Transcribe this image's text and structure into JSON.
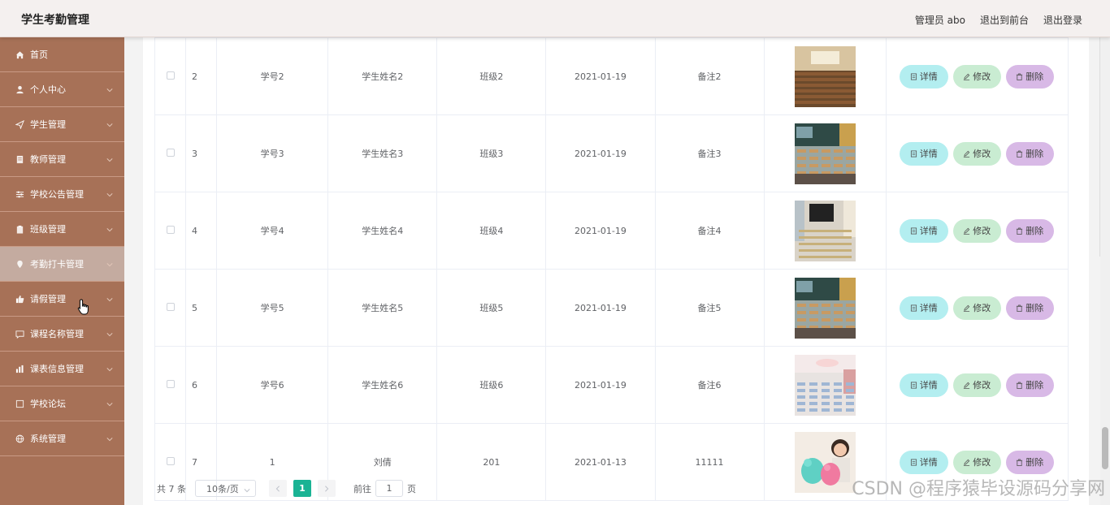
{
  "app": {
    "title": "学生考勤管理"
  },
  "header": {
    "user_label": "管理员 abo",
    "to_front": "退出到前台",
    "logout": "退出登录"
  },
  "sidebar": {
    "items": [
      {
        "label": "首页",
        "icon": "home-icon",
        "has_children": false
      },
      {
        "label": "个人中心",
        "icon": "user-icon",
        "has_children": true
      },
      {
        "label": "学生管理",
        "icon": "send-icon",
        "has_children": true
      },
      {
        "label": "教师管理",
        "icon": "document-icon",
        "has_children": true
      },
      {
        "label": "学校公告管理",
        "icon": "sliders-icon",
        "has_children": true
      },
      {
        "label": "班级管理",
        "icon": "clipboard-icon",
        "has_children": true
      },
      {
        "label": "考勤打卡管理",
        "icon": "location-icon",
        "has_children": true,
        "active": true
      },
      {
        "label": "请假管理",
        "icon": "thumb-icon",
        "has_children": true
      },
      {
        "label": "课程名称管理",
        "icon": "chat-icon",
        "has_children": true
      },
      {
        "label": "课表信息管理",
        "icon": "chart-icon",
        "has_children": true
      },
      {
        "label": "学校论坛",
        "icon": "square-icon",
        "has_children": true
      },
      {
        "label": "系统管理",
        "icon": "globe-icon",
        "has_children": true
      }
    ]
  },
  "table": {
    "rows": [
      {
        "index": "2",
        "student_no": "学号2",
        "name": "学生姓名2",
        "class": "班级2",
        "date": "2021-01-19",
        "note": "备注2",
        "photo": "classroom-hall"
      },
      {
        "index": "3",
        "student_no": "学号3",
        "name": "学生姓名3",
        "class": "班级3",
        "date": "2021-01-19",
        "note": "备注3",
        "photo": "classroom-desks"
      },
      {
        "index": "4",
        "student_no": "学号4",
        "name": "学生姓名4",
        "class": "班级4",
        "date": "2021-01-19",
        "note": "备注4",
        "photo": "classroom-screen"
      },
      {
        "index": "5",
        "student_no": "学号5",
        "name": "学生姓名5",
        "class": "班级5",
        "date": "2021-01-19",
        "note": "备注5",
        "photo": "classroom-desks"
      },
      {
        "index": "6",
        "student_no": "学号6",
        "name": "学生姓名6",
        "class": "班级6",
        "date": "2021-01-19",
        "note": "备注6",
        "photo": "classroom-bright"
      },
      {
        "index": "7",
        "student_no": "1",
        "name": "刘倩",
        "class": "201",
        "date": "2021-01-13",
        "note": "11111",
        "photo": "girl-with-toys"
      }
    ],
    "actions": {
      "detail": "详情",
      "edit": "修改",
      "delete": "删除"
    }
  },
  "pagination": {
    "total": "共 7 条",
    "page_size": "10条/页",
    "current_page": "1",
    "goto_prefix": "前往",
    "goto_value": "1",
    "goto_suffix": "页"
  },
  "watermark": "CSDN @程序猿毕设源码分享网",
  "colors": {
    "sidebar": "#a77157",
    "active_item": "#c4aba0",
    "page_active": "#1ab394",
    "btn_detail": "#b3eef0",
    "btn_edit": "#c9ecd2",
    "btn_delete": "#d8b9e6"
  }
}
